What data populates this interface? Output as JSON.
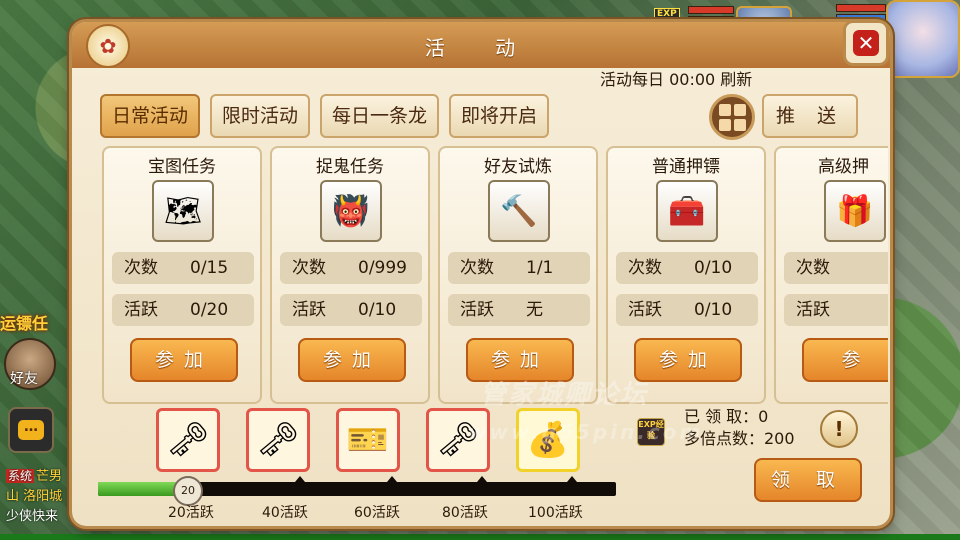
{
  "window": {
    "title": "活 动",
    "reset_note": "活动每日 00:00 刷新"
  },
  "tabs": [
    {
      "label": "日常活动",
      "active": true
    },
    {
      "label": "限时活动",
      "active": false
    },
    {
      "label": "每日一条龙",
      "active": false
    },
    {
      "label": "即将开启",
      "active": false
    }
  ],
  "push_label": "推 送",
  "cards": [
    {
      "title": "宝图任务",
      "icon": "treasure-map-icon",
      "glyph": "🗺",
      "count_label": "次数",
      "count": "0/15",
      "active_label": "活跃",
      "active": "0/20",
      "button": "参加"
    },
    {
      "title": "捉鬼任务",
      "icon": "ghost-mask-icon",
      "glyph": "👹",
      "count_label": "次数",
      "count": "0/999",
      "active_label": "活跃",
      "active": "0/10",
      "button": "参加"
    },
    {
      "title": "好友试炼",
      "icon": "mace-icon",
      "glyph": "🔨",
      "count_label": "次数",
      "count": "1/1",
      "active_label": "活跃",
      "active": "无",
      "button": "参加"
    },
    {
      "title": "普通押镖",
      "icon": "chest-icon",
      "glyph": "🧰",
      "count_label": "次数",
      "count": "0/10",
      "active_label": "活跃",
      "active": "0/10",
      "button": "参加"
    },
    {
      "title": "高级押",
      "icon": "gold-chest-icon",
      "glyph": "🎁",
      "count_label": "次数",
      "count": "",
      "active_label": "活跃",
      "active": "",
      "button": "参"
    }
  ],
  "rewards": {
    "progress_value": 20,
    "progress_max": 100,
    "knob_label": "20",
    "milestones": [
      {
        "label": "20活跃",
        "icon": "key-icon",
        "glyph": "🗝",
        "highlight": "red"
      },
      {
        "label": "40活跃",
        "icon": "key-icon",
        "glyph": "🗝",
        "highlight": "red"
      },
      {
        "label": "60活跃",
        "icon": "vip-card-icon",
        "glyph": "🎫",
        "highlight": "red"
      },
      {
        "label": "80活跃",
        "icon": "key-icon",
        "glyph": "🗝",
        "highlight": "red"
      },
      {
        "label": "100活跃",
        "icon": "lucky-bag-icon",
        "glyph": "💰",
        "highlight": "gold"
      }
    ],
    "claimed_label": "已 领 取：0",
    "multiplier_label": "多倍点数：200",
    "x2_icon_text": "EXP经验",
    "claim_button": "领 取"
  },
  "hud": {
    "quest_tag": "运镖任",
    "friend_label": "好友",
    "chat_icon": "…",
    "chat_lines": [
      {
        "tag": "系统",
        "text": "芒男"
      },
      {
        "tag": "",
        "text": "山 洛阳城"
      },
      {
        "tag": "",
        "text": "少侠快来"
      }
    ],
    "exp_badge": "EXP"
  },
  "watermark": {
    "line1": "管家城卿论坛",
    "line2": "www.g55pin.com"
  },
  "colors": {
    "accent": "#e5862a",
    "panel": "#f2e6c6",
    "title_bar": "#c8853f",
    "progress": "#58b83a"
  }
}
